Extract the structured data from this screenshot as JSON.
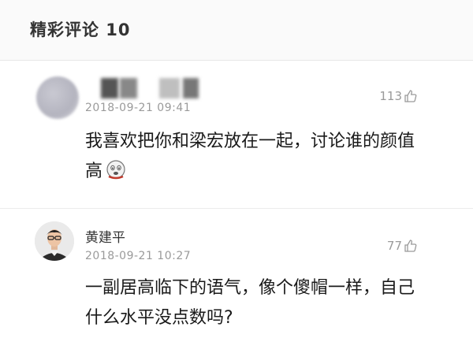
{
  "header": {
    "title": "精彩评论 10"
  },
  "comments": [
    {
      "username": "",
      "timestamp": "2018-09-21 09:41",
      "likes": "113",
      "text": "我喜欢把你和梁宏放在一起，讨论谁的颜值高",
      "emoji": "crying-face-emoji"
    },
    {
      "username": "黄建平",
      "timestamp": "2018-09-21 10:27",
      "likes": "77",
      "text": "一副居高临下的语气，像个傻帽一样，自己什么水平没点数吗?"
    }
  ],
  "icons": {
    "like": "thumbs-up-icon"
  },
  "colors": {
    "meta_text": "#9a9a9a",
    "body_text": "#1a1a1a",
    "background": "#f5f5f5"
  }
}
